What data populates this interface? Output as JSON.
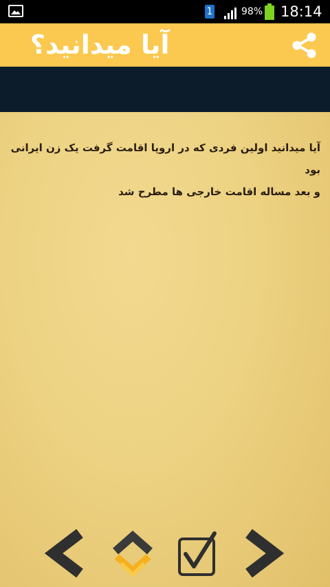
{
  "status_bar": {
    "sim_label": "1",
    "battery_percent": "98%",
    "time": "18:14",
    "icons": [
      "image-notification-icon",
      "sim-icon",
      "signal-icon",
      "battery-icon"
    ],
    "battery_color": "#7ed321"
  },
  "app_bar": {
    "title": "آیا میدانید؟",
    "share_icon": "share-icon",
    "background_color": "#fbc94f"
  },
  "fact": {
    "line1": "آیا میدانید اولین فردی که در اروپا اقامت گرفت یک زن ایرانی بود",
    "line2": "و بعد مساله اقامت خارجی ها مطرح شد"
  },
  "nav": {
    "buttons": [
      {
        "icon": "chevron-left-icon"
      },
      {
        "icon": "up-down-arrows-icon"
      },
      {
        "icon": "checkbox-icon"
      },
      {
        "icon": "chevron-right-icon"
      }
    ]
  }
}
